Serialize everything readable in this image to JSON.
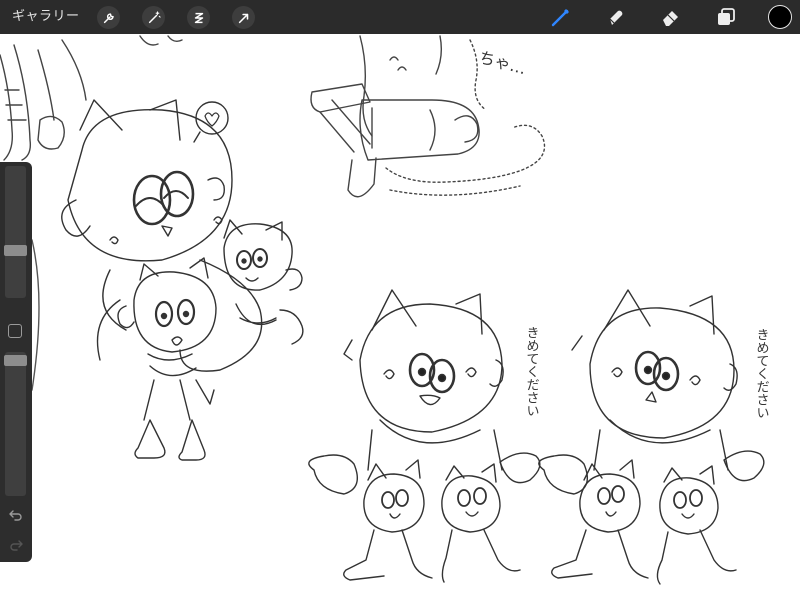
{
  "topbar": {
    "gallery_label": "ギャラリー",
    "left_tools": [
      "wrench-icon",
      "magic-wand-icon",
      "selection-icon",
      "transform-arrow-icon"
    ],
    "right_tools": [
      "brush-icon",
      "smudge-icon",
      "eraser-icon",
      "layers-icon"
    ],
    "active_tool": "brush-icon",
    "active_color": "#000000",
    "accent_color": "#2f86ff"
  },
  "sidebar": {
    "brush_size": 0.35,
    "opacity": 0.98,
    "buttons": [
      "modify-square",
      "undo-icon",
      "redo-icon"
    ]
  },
  "canvas": {
    "annotations": {
      "chatter": "ちゃ…",
      "caption_left": "きめてください",
      "caption_right": "きめてください"
    }
  }
}
